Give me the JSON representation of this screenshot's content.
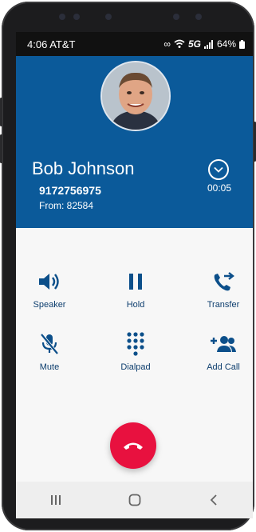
{
  "status_bar": {
    "time_carrier": "4:06 AT&T",
    "network": "5G",
    "battery": "64%"
  },
  "caller": {
    "name": "Bob Johnson",
    "number": "9172756975",
    "from": "From: 82584",
    "duration": "00:05"
  },
  "controls": {
    "speaker": "Speaker",
    "hold": "Hold",
    "transfer": "Transfer",
    "mute": "Mute",
    "dialpad": "Dialpad",
    "add_call": "Add Call"
  },
  "colors": {
    "header_bg": "#0b5a9a",
    "icon_blue": "#0c4f8a",
    "end_call_red": "#e8113f"
  },
  "icons": {
    "collapse": "chevron-down-circle-icon",
    "speaker": "speaker-icon",
    "hold": "pause-icon",
    "transfer": "phone-transfer-icon",
    "mute": "mic-off-icon",
    "dialpad": "dialpad-icon",
    "add_call": "add-person-icon",
    "end_call": "hang-up-icon"
  }
}
